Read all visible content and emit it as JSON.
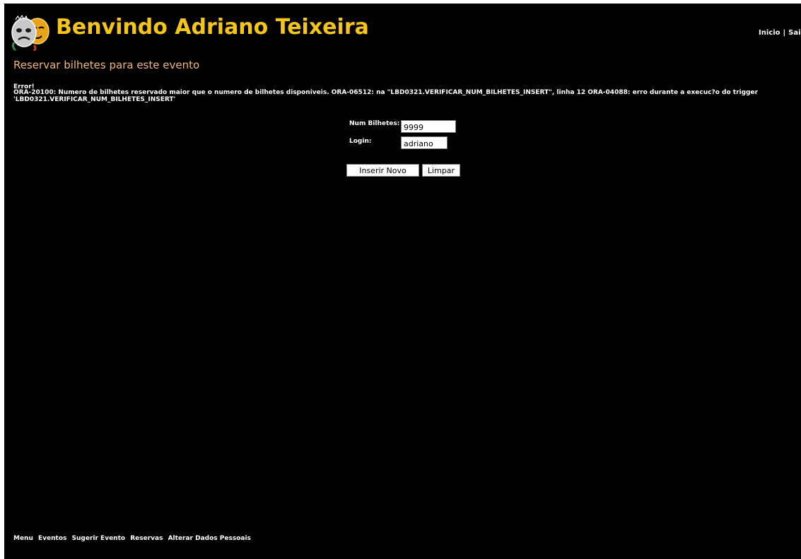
{
  "header": {
    "welcome": "Benvindo Adriano Teixeira",
    "logo_icon": "theater-masks-icon",
    "nav": [
      "Inicio",
      "Sair"
    ]
  },
  "page": {
    "title": "Reservar bilhetes para este evento"
  },
  "error": {
    "label": "Error!",
    "message": "ORA-20100: Numero de bilhetes reservado maior que o numero de bilhetes disponiveis. ORA-06512: na \"LBD0321.VERIFICAR_NUM_BILHETES_INSERT\", linha 12 ORA-04088: erro durante a execuc?o do trigger 'LBD0321.VERIFICAR_NUM_BILHETES_INSERT'"
  },
  "form": {
    "num_bilhetes_label": "Num Bilhetes:",
    "num_bilhetes_value": "9999",
    "login_label": "Login:",
    "login_value": "adriano",
    "submit_label": "Inserir Novo",
    "reset_label": "Limpar"
  },
  "footer": {
    "links": [
      "Menu",
      "Eventos",
      "Sugerir Evento",
      "Reservas",
      "Alterar Dados Pessoais"
    ]
  },
  "colors": {
    "background": "#000000",
    "welcome": "#f5c518",
    "page_title": "#f0b87c",
    "text": "#ffffff"
  }
}
